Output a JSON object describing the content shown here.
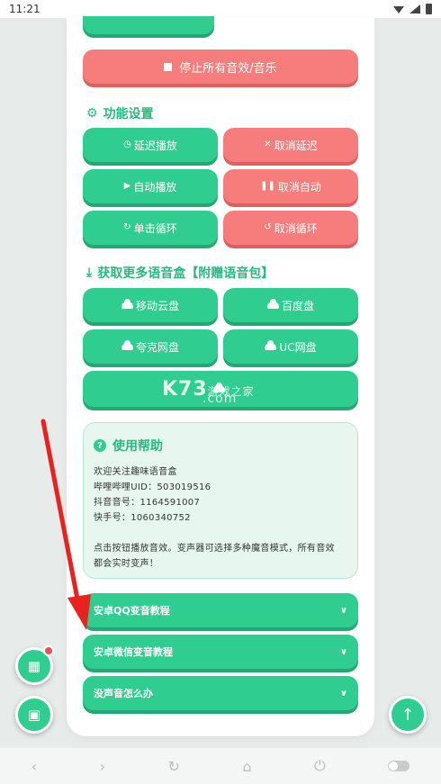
{
  "status_bar": {
    "time": "11:21"
  },
  "top_partial_button": {
    "label": ""
  },
  "stop_all_button": {
    "icon": "stop-icon",
    "label": "停止所有音效/音乐"
  },
  "settings_section": {
    "title": "功能设置",
    "icon": "gear-icon",
    "buttons": [
      {
        "icon": "clock-icon",
        "label": "延迟播放",
        "color": "#2fce90"
      },
      {
        "icon": "close-icon",
        "label": "取消延迟",
        "color": "#f77c7c"
      },
      {
        "icon": "play-icon",
        "label": "自动播放",
        "color": "#2fce90"
      },
      {
        "icon": "pause-icon",
        "label": "取消自动",
        "color": "#f77c7c"
      },
      {
        "icon": "redo-icon",
        "label": "单击循环",
        "color": "#2fce90"
      },
      {
        "icon": "undo-icon",
        "label": "取消循环",
        "color": "#f77c7c"
      }
    ]
  },
  "download_section": {
    "title": "获取更多语音盒【附赠语音包】",
    "icon": "download-icon",
    "buttons": [
      {
        "icon": "cloud-icon",
        "label": "移动云盘"
      },
      {
        "icon": "cloud-icon",
        "label": "百度盘"
      },
      {
        "icon": "cloud-icon",
        "label": "夸克网盘"
      },
      {
        "icon": "cloud-icon",
        "label": "UC网盘"
      },
      {
        "icon": "cloud-icon",
        "label": ""
      }
    ]
  },
  "watermark": {
    "text": "K73",
    "subtitle": "游戏之家",
    "domain": ".com"
  },
  "help": {
    "title": "使用帮助",
    "lines": [
      "欢迎关注趣味语音盒",
      "哔哩哔哩UID：503019516",
      "抖音音号：1164591007",
      "快手号：1060340752",
      "",
      "点击按钮播放音效。变声器可选择多种魔音模式，所有音效",
      "都会实时变声！"
    ]
  },
  "accordions": [
    {
      "label": "安卓QQ变音教程",
      "icon": "chevron-down-icon"
    },
    {
      "label": "安卓微信变音教程",
      "icon": "chevron-down-icon"
    },
    {
      "label": "没声音怎么办",
      "icon": "chevron-down-icon"
    }
  ],
  "fabs": {
    "grid": "grid-icon",
    "toolbox": "toolbox-icon",
    "scroll_top": "arrow-up-icon"
  },
  "colors": {
    "green": "#2fce90",
    "red": "#f77c7c",
    "arrow": "#e8231f"
  }
}
